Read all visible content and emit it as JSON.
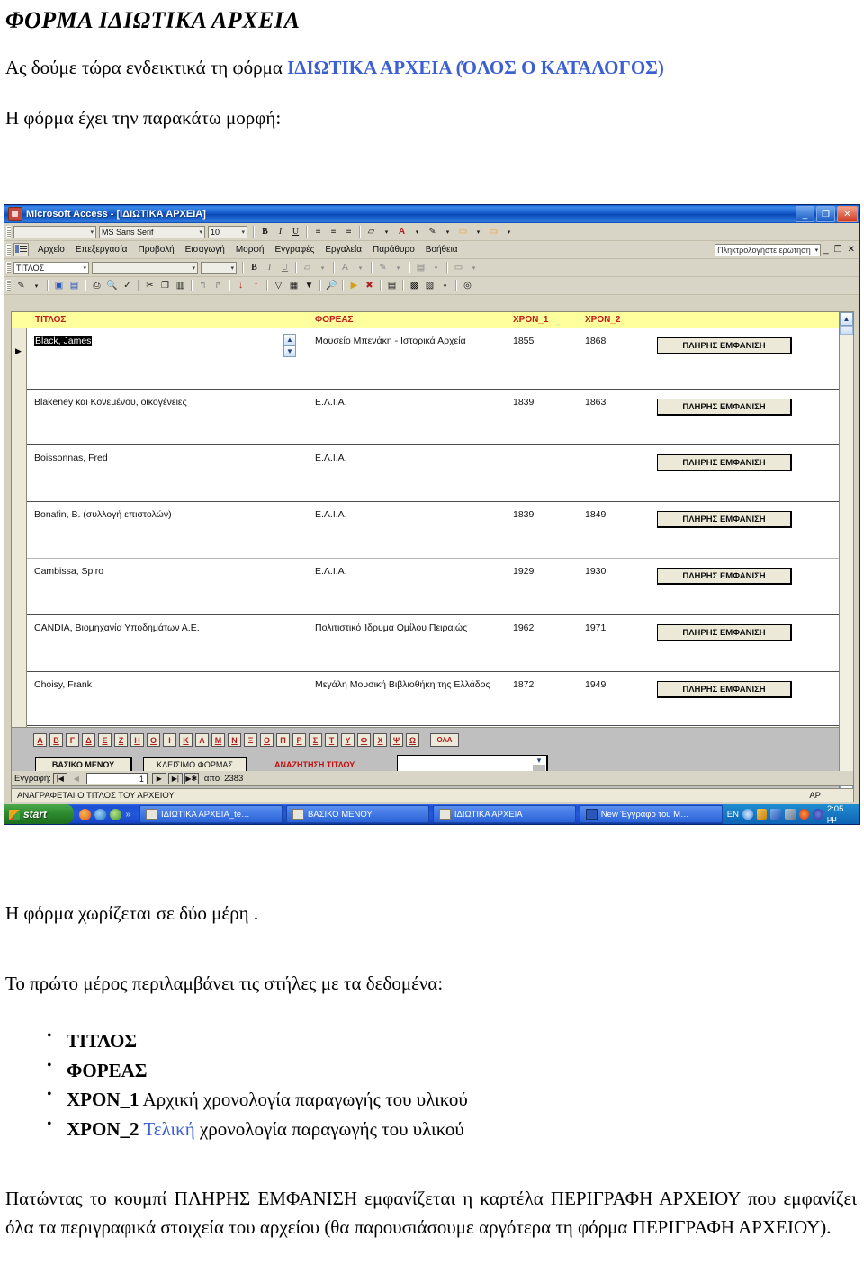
{
  "document": {
    "title": "ΦΟΡΜΑ ΙΔΙΩΤΙΚΑ ΑΡΧΕΙΑ",
    "intro_plain": "Ας δούμε τώρα ενδεικτικά  τη φόρμα ",
    "intro_highlight": "ΙΔΙΩΤΙΚΑ ΑΡΧΕΙΑ (ΌΛΟΣ Ο ΚΑΤΑΛΟΓΟΣ)",
    "intro_second": "Η φόρμα έχει την παρακάτω μορφή:",
    "after_1": "Η φόρμα χωρίζεται σε δύο μέρη .",
    "after_2": "Το πρώτο μέρος περιλαμβάνει τις στήλες με τα δεδομένα:",
    "bullets": [
      {
        "bold": "ΤΙΤΛΟΣ",
        "rest": ""
      },
      {
        "bold": "ΦΟΡΕΑΣ",
        "rest": ""
      },
      {
        "bold": "ΧΡΟΝ_1",
        "rest": " Αρχική χρονολογία παραγωγής του υλικού"
      },
      {
        "bold": "ΧΡΟΝ_2",
        "blue": " Τελική",
        "rest": " χρονολογία παραγωγής του υλικού"
      }
    ],
    "closing": "Πατώντας το κουμπί ΠΛΗΡΗΣ ΕΜΦΑΝΙΣΗ εμφανίζεται η καρτέλα ΠΕΡΙΓΡΑΦΗ ΑΡΧΕΙΟΥ που εμφανίζει όλα τα περιγραφικά στοιχεία του αρχείου (θα παρουσιάσουμε αργότερα τη φόρμα ΠΕΡΙΓΡΑΦΗ ΑΡΧΕΙΟΥ).",
    "link_color": "#3c5fd1"
  },
  "access": {
    "titlebar": {
      "text": "Microsoft Access - [ΙΔΙΩΤΙΚΑ ΑΡΧΕΙΑ]",
      "minimize": "_",
      "restore": "❐",
      "close": "✕"
    },
    "format_toolbar": {
      "object_combo": "",
      "font_combo": "MS Sans Serif",
      "size_combo": "10",
      "bold": "B",
      "italic": "I",
      "underline": "U",
      "align_left": "≡",
      "align_center": "≡",
      "align_right": "≡",
      "fill_color": "▱",
      "font_color": "A",
      "line_color": "✎",
      "special1": "▭",
      "special2": "▭"
    },
    "menu": {
      "items": [
        "Αρχείο",
        "Επεξεργασία",
        "Προβολή",
        "Εισαγωγή",
        "Μορφή",
        "Εγγραφές",
        "Εργαλεία",
        "Παράθυρο",
        "Βοήθεια"
      ],
      "ask_placeholder": "Πληκτρολογήστε ερώτηση",
      "mini_minimize": "_",
      "mini_restore": "❐",
      "mini_close": "✕"
    },
    "formatting_toolbar2": {
      "object": "ΤΙΤΛΟΣ",
      "font": "",
      "size": "",
      "bold": "B",
      "italic": "I",
      "underline": "U"
    },
    "standard_toolbar": {
      "icons": [
        "pencil-icon",
        "save-icon",
        "print-preview-icon",
        "print-icon",
        "zoom-icon",
        "spelling-icon",
        "cut-icon",
        "copy-icon",
        "paste-icon",
        "undo-icon",
        "redo-icon",
        "sort-asc-icon",
        "sort-desc-icon",
        "filter-icon",
        "filter-window-icon",
        "remove-filter-icon",
        "find-icon",
        "new-record-icon",
        "delete-record-icon",
        "properties-icon",
        "database-window-icon",
        "new-object-icon",
        "help-icon"
      ]
    }
  },
  "form": {
    "columns": [
      "ΤΙΤΛΟΣ",
      "ΦΟΡΕΑΣ",
      "ΧΡΟΝ_1",
      "ΧΡΟΝ_2"
    ],
    "full_display_button": "ΠΛΗΡΗΣ ΕΜΦΑΝΙΣΗ",
    "rows": [
      {
        "titlos": "Black, James",
        "foreas": "Μουσείο Μπενάκη - Ιστορικά Αρχεία",
        "xron1": "1855",
        "xron2": "1868",
        "selected": true
      },
      {
        "titlos": "Blakeney και Κονεμένου, οικογένειες",
        "foreas": "Ε.Λ.Ι.Α.",
        "xron1": "1839",
        "xron2": "1863",
        "selected": false
      },
      {
        "titlos": "Boissonnas, Fred",
        "foreas": "Ε.Λ.Ι.Α.",
        "xron1": "",
        "xron2": "",
        "selected": false
      },
      {
        "titlos": "Bonafin, B. (συλλογή επιστολών)",
        "foreas": "Ε.Λ.Ι.Α.",
        "xron1": "1839",
        "xron2": "1849",
        "selected": false
      },
      {
        "titlos": "Cambissa, Spiro",
        "foreas": "Ε.Λ.Ι.Α.",
        "xron1": "1929",
        "xron2": "1930",
        "selected": false
      },
      {
        "titlos": "CANDIA, Βιομηχανία Υποδημάτων Α.Ε.",
        "foreas": "Πολιτιστικό Ίδρυμα Ομίλου Πειραιώς",
        "xron1": "1962",
        "xron2": "1971",
        "selected": false
      },
      {
        "titlos": "Choisy, Frank",
        "foreas": "Μεγάλη Μουσική Βιβλιοθήκη της Ελλάδος",
        "xron1": "1872",
        "xron2": "1949",
        "selected": false
      }
    ],
    "alphabet_buttons": [
      "Α",
      "Β",
      "Γ",
      "Δ",
      "Ε",
      "Ζ",
      "Η",
      "Θ",
      "Ι",
      "Κ",
      "Λ",
      "Μ",
      "Ν",
      "Ξ",
      "Ο",
      "Π",
      "Ρ",
      "Σ",
      "Τ",
      "Υ",
      "Φ",
      "Χ",
      "Ψ",
      "Ω"
    ],
    "all_button": "ΟΛΑ",
    "basic_menu_button": "ΒΑΣΙΚΟ ΜΕΝΟΥ",
    "close_form_button": "ΚΛΕΙΣΙΜΟ ΦΟΡΜΑΣ",
    "search_label": "ΑΝΑΖΗΤΗΣΗ ΤΙΤΛΟΥ",
    "search_value": "",
    "header_bg": "#ffff9e",
    "header_text_color": "#c21a1a"
  },
  "record_nav": {
    "label": "Εγγραφή:",
    "first": "|◀",
    "prev": "◀",
    "value": "1",
    "next": "▶",
    "last": "▶|",
    "new": "▶✱",
    "of_label": "από",
    "total": "2383"
  },
  "status_bar": {
    "text": "ΑΝΑΓΡΑΦΕΤΑΙ Ο ΤΙΤΛΟΣ ΤΟΥ ΑΡΧΕΙΟΥ",
    "right": "ΑΡ"
  },
  "taskbar": {
    "start": "start",
    "quick_launch": [
      "firefox-icon",
      "internet-explorer-icon",
      "media-icon",
      "chevron-right-icon"
    ],
    "items": [
      {
        "label": "ΙΔΙΩΤΙΚΑ ΑΡΧΕΙΑ_te…",
        "icon": "access-doc-icon"
      },
      {
        "label": "ΒΑΣΙΚΟ ΜΕΝΟΥ",
        "icon": "access-form-icon"
      },
      {
        "label": "ΙΔΙΩΤΙΚΑ ΑΡΧΕΙΑ",
        "icon": "access-form-icon"
      },
      {
        "label": "New Έγγραφο του Μ…",
        "icon": "word-doc-icon"
      }
    ],
    "language": "EN",
    "clock": "2:05 μμ"
  }
}
